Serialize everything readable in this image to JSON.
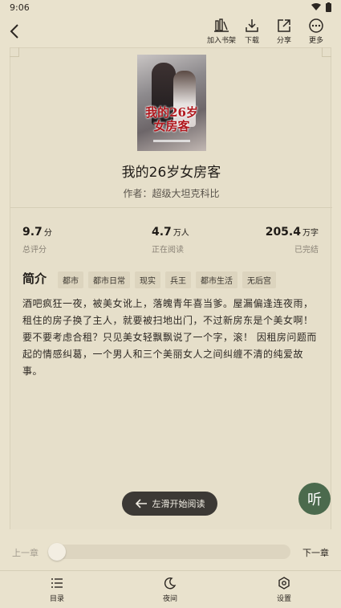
{
  "status": {
    "time": "9:06"
  },
  "toolbar": {
    "add_shelf": "加入书架",
    "download": "下载",
    "share": "分享",
    "more": "更多"
  },
  "book": {
    "cover_title": "我的26岁女房客",
    "title": "我的26岁女房客",
    "author_line": "作者：超级大坦克科比"
  },
  "stats": [
    {
      "value": "9.7",
      "unit": "分",
      "caption": "总评分"
    },
    {
      "value": "4.7",
      "unit": "万人",
      "caption": "正在阅读"
    },
    {
      "value": "205.4",
      "unit": "万字",
      "caption": "已完结"
    }
  ],
  "intro": {
    "heading": "简介",
    "tags": [
      "都市",
      "都市日常",
      "现实",
      "兵王",
      "都市生活",
      "无后宫"
    ],
    "description": "酒吧疯狂一夜，被美女讹上，落魄青年喜当爹。屋漏偏逢连夜雨，租住的房子换了主人，就要被扫地出门，不过新房东是个美女啊！要不要考虑合租？只见美女轻飘飘说了一个字，滚！ 因租房问题而起的情感纠葛，一个男人和三个美丽女人之间纠缠不清的纯爱故事。"
  },
  "swipe_hint": "左滑开始阅读",
  "listen": "听",
  "chapter": {
    "prev": "上一章",
    "next": "下一章",
    "progress": 0
  },
  "nav": {
    "catalog": "目录",
    "night": "夜间",
    "settings": "设置"
  }
}
